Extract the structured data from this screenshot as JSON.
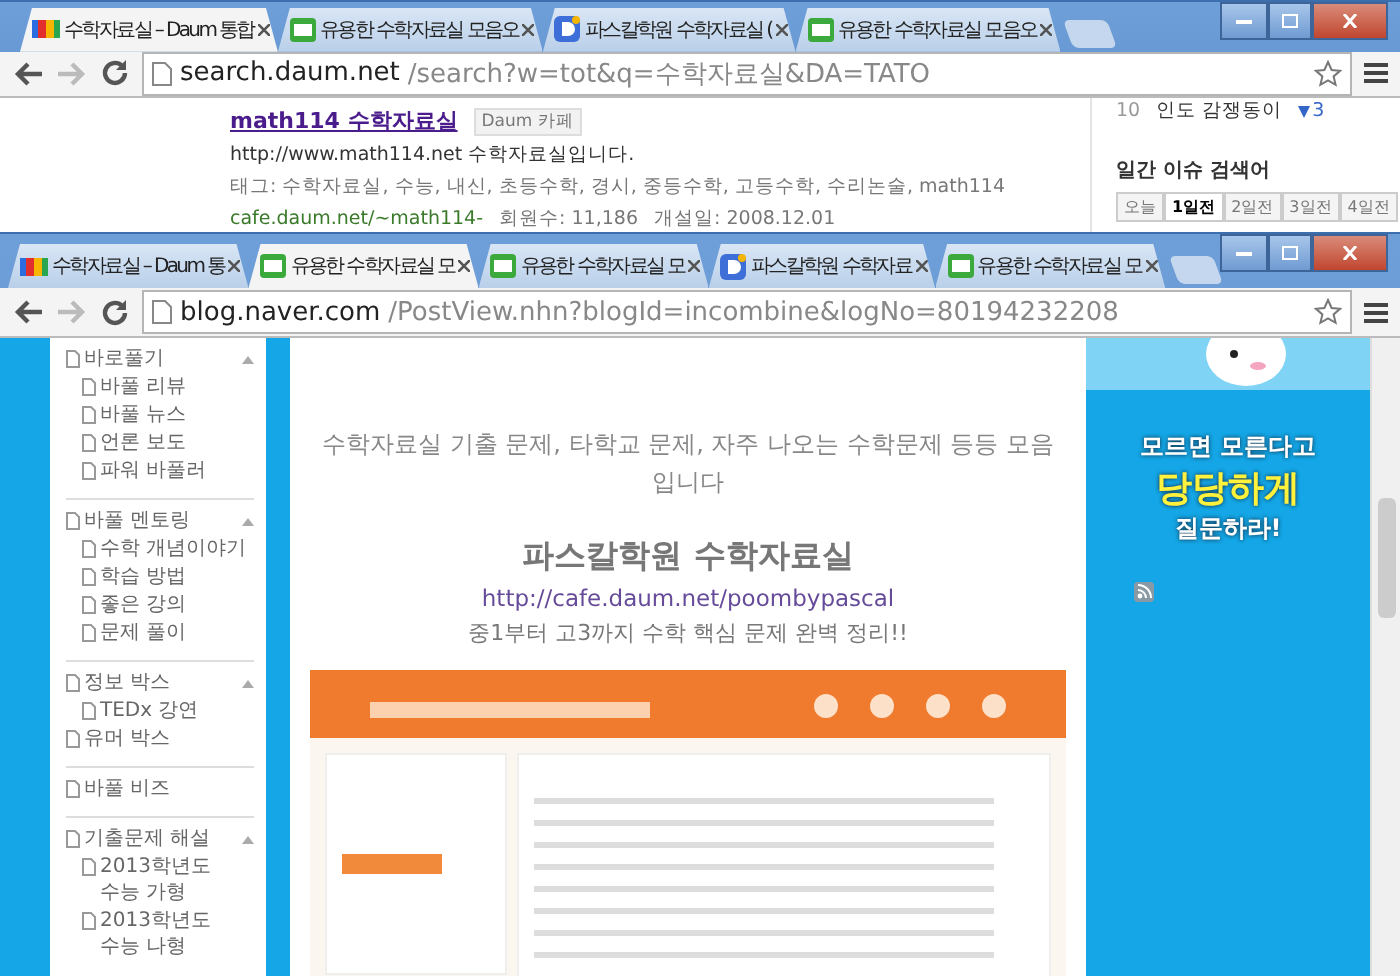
{
  "back_window": {
    "tabs": [
      {
        "kind": "daum",
        "label": "수학자료실 – Daum 통합",
        "selected": true
      },
      {
        "kind": "blog",
        "label": "유용한 수학자료실 모음오",
        "selected": false
      },
      {
        "kind": "d",
        "label": "파스칼학원 수학자료실 (",
        "selected": false
      },
      {
        "kind": "blog",
        "label": "유용한 수학자료실 모음오",
        "selected": false
      }
    ],
    "address": {
      "host": "search.daum.net",
      "path": "/search?w=tot&q=수학자료실&DA=TATO"
    },
    "result": {
      "title": "math114 수학자료실",
      "badge": "Daum 카페",
      "url": "http://www.math114.net 수학자료실입니다.",
      "tags": "태그: 수학자료실, 수능, 내신, 초등수학, 경시, 중등수학, 고등수학, 수리논술, math114",
      "link": "cafe.daum.net/~math114-",
      "members": "회원수: 11,186",
      "created": "개설일: 2008.12.01"
    },
    "issues": {
      "rank": "10",
      "keyword": "인도 감쟁동이",
      "change": "3",
      "title": "일간 이슈 검색어",
      "days": [
        {
          "label": "오늘",
          "selected": false
        },
        {
          "label": "1일전",
          "selected": true
        },
        {
          "label": "2일전",
          "selected": false
        },
        {
          "label": "3일전",
          "selected": false
        },
        {
          "label": "4일전",
          "selected": false
        }
      ]
    }
  },
  "front_window": {
    "tabs": [
      {
        "kind": "daum",
        "label": "수학자료실 – Daum 통",
        "selected": false
      },
      {
        "kind": "blog",
        "label": "유용한 수학자료실 모",
        "selected": true
      },
      {
        "kind": "blog",
        "label": "유용한 수학자료실 모",
        "selected": false
      },
      {
        "kind": "d",
        "label": "파스칼학원 수학자료",
        "selected": false
      },
      {
        "kind": "blog",
        "label": "유용한 수학자료실 모",
        "selected": false
      }
    ],
    "address": {
      "host": "blog.naver.com",
      "path": "/PostView.nhn?blogId=incombine&logNo=80194232208"
    },
    "sidebar": [
      {
        "items": [
          {
            "label": "바로풀기",
            "expanded": true,
            "children": [
              {
                "label": "바풀 리뷰"
              },
              {
                "label": "바풀 뉴스"
              },
              {
                "label": "언론 보도"
              },
              {
                "label": "파워 바풀러"
              }
            ]
          }
        ]
      },
      {
        "items": [
          {
            "label": "바풀 멘토링",
            "expanded": true,
            "children": [
              {
                "label": "수학 개념이야기"
              },
              {
                "label": "학습 방법"
              },
              {
                "label": "좋은 강의"
              },
              {
                "label": "문제 풀이"
              }
            ]
          }
        ]
      },
      {
        "items": [
          {
            "label": "정보 박스",
            "expanded": true,
            "children": [
              {
                "label": "TEDx 강연"
              }
            ]
          },
          {
            "label": "유머 박스",
            "expanded": false
          }
        ]
      },
      {
        "items": [
          {
            "label": "바풀 비즈",
            "expanded": false
          }
        ]
      },
      {
        "items": [
          {
            "label": "기출문제 해설",
            "expanded": true,
            "children": [
              {
                "label": "2013학년도 수능 가형"
              },
              {
                "label": "2013학년도 수능 나형"
              }
            ]
          }
        ]
      }
    ],
    "post": {
      "intro": "수학자료실 기출 문제, 타학교 문제, 자주 나오는 수학문제 등등 모음입니다",
      "heading": "파스칼학원 수학자료실",
      "link": "http://cafe.daum.net/poombypascal",
      "tagline": "중1부터 고3까지 수학 핵심 문제 완벽 정리!!"
    },
    "banner": {
      "line_1": "모르면 모른다고",
      "line_2": "당당하게",
      "line_3": "질문하라!"
    }
  }
}
